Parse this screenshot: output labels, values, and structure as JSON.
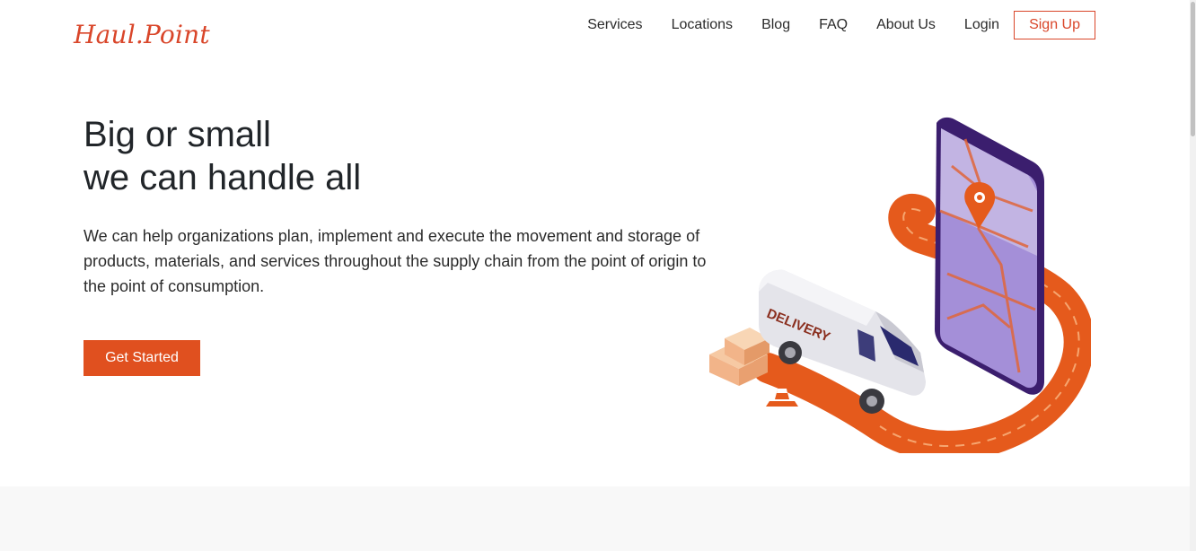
{
  "brand": {
    "name": "Haul",
    "dot": ".",
    "name2": "Point",
    "color": "#d9462a"
  },
  "nav": {
    "items": [
      {
        "label": "Services"
      },
      {
        "label": "Locations"
      },
      {
        "label": "Blog"
      },
      {
        "label": "FAQ"
      },
      {
        "label": "About Us"
      },
      {
        "label": "Login"
      }
    ],
    "signup_label": "Sign Up"
  },
  "hero": {
    "title_line1": "Big or small",
    "title_line2": "we can handle all",
    "description": "We can help organizations plan, implement and execute the movement and storage of products, materials, and services throughout the supply chain from the point of origin to the point of consumption.",
    "cta_label": "Get Started",
    "cta_color": "#e0501f",
    "van_label": "DELIVERY"
  },
  "icons": {
    "illustration": "delivery-van-phone-map-illustration"
  }
}
